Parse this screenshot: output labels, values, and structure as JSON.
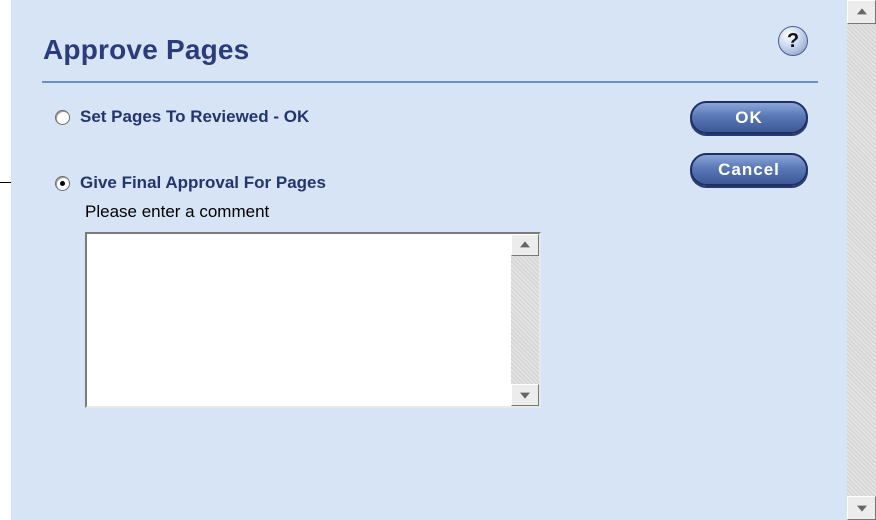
{
  "dialog": {
    "title": "Approve Pages",
    "help_symbol": "?",
    "options": [
      {
        "label": "Set Pages To Reviewed - OK",
        "checked": false
      },
      {
        "label": "Give Final Approval For Pages",
        "checked": true
      }
    ],
    "comment_label": "Please enter a comment",
    "comment_value": ""
  },
  "buttons": {
    "ok_label": "OK",
    "cancel_label": "Cancel"
  },
  "colors": {
    "panel_background": "#d6e4f5",
    "title_text": "#2a3d7a",
    "button_fill": "#5a78b6"
  }
}
